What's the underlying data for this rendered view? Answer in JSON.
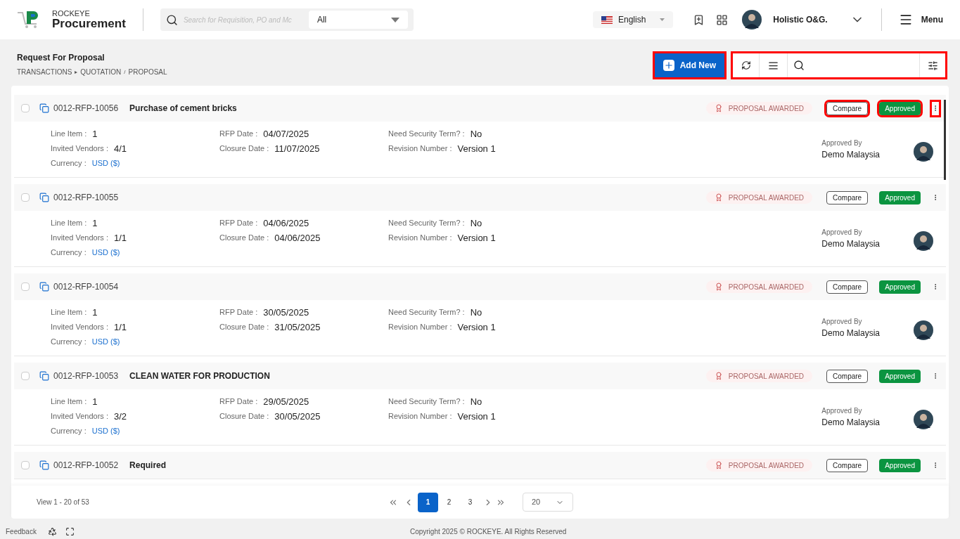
{
  "header": {
    "brand_top": "ROCKEYE",
    "brand_name": "Procurement",
    "search_placeholder": "Search for Requisition, PO and Mc",
    "search_scope": "All",
    "language": "English",
    "user_name": "Holistic O&G.",
    "menu_label": "Menu"
  },
  "page": {
    "title": "Request For Proposal",
    "breadcrumb": [
      {
        "label": "TRANSACTIONS",
        "sep": "▸"
      },
      {
        "label": "QUOTATION",
        "sep": "/"
      },
      {
        "label": "PROPOSAL"
      }
    ]
  },
  "toolbar": {
    "add_label": "Add New",
    "add_highlighted": true,
    "tools_highlighted": true
  },
  "rows": [
    {
      "checked": false,
      "number": "0012-RFP-10056",
      "title": "Purchase of cement bricks",
      "status": "PROPOSAL AWARDED",
      "compare": "Compare",
      "approval": "Approved",
      "highlighted": true,
      "details": {
        "columns": [
          [
            {
              "label": "Line Item :",
              "value": "1"
            },
            {
              "label": "Invited Vendors :",
              "value": "4/1"
            },
            {
              "label": "Currency :",
              "value": "USD ($)",
              "kind": "link"
            }
          ],
          [
            {
              "label": "RFP Date :",
              "value": "04/07/2025"
            },
            {
              "label": "Closure Date :",
              "value": "11/07/2025"
            }
          ],
          [
            {
              "label": "Need Security Term? :",
              "value": "No"
            },
            {
              "label": "Revision Number :",
              "value": "Version 1"
            }
          ]
        ],
        "approved_by_label": "Approved By",
        "approver": "Demo Malaysia"
      }
    },
    {
      "checked": false,
      "number": "0012-RFP-10055",
      "status": "PROPOSAL AWARDED",
      "compare": "Compare",
      "approval": "Approved",
      "highlighted": false,
      "details": {
        "columns": [
          [
            {
              "label": "Line Item :",
              "value": "1"
            },
            {
              "label": "Invited Vendors :",
              "value": "1/1"
            },
            {
              "label": "Currency :",
              "value": "USD ($)",
              "kind": "link"
            }
          ],
          [
            {
              "label": "RFP Date :",
              "value": "04/06/2025"
            },
            {
              "label": "Closure Date :",
              "value": "04/06/2025"
            }
          ],
          [
            {
              "label": "Need Security Term? :",
              "value": "No"
            },
            {
              "label": "Revision Number :",
              "value": "Version 1"
            }
          ]
        ],
        "approved_by_label": "Approved By",
        "approver": "Demo Malaysia"
      }
    },
    {
      "checked": false,
      "number": "0012-RFP-10054",
      "status": "PROPOSAL AWARDED",
      "compare": "Compare",
      "approval": "Approved",
      "highlighted": false,
      "details": {
        "columns": [
          [
            {
              "label": "Line Item :",
              "value": "1"
            },
            {
              "label": "Invited Vendors :",
              "value": "1/1"
            },
            {
              "label": "Currency :",
              "value": "USD ($)",
              "kind": "link"
            }
          ],
          [
            {
              "label": "RFP Date :",
              "value": "30/05/2025"
            },
            {
              "label": "Closure Date :",
              "value": "31/05/2025"
            }
          ],
          [
            {
              "label": "Need Security Term? :",
              "value": "No"
            },
            {
              "label": "Revision Number :",
              "value": "Version 1"
            }
          ]
        ],
        "approved_by_label": "Approved By",
        "approver": "Demo Malaysia"
      }
    },
    {
      "checked": false,
      "number": "0012-RFP-10053",
      "title": "CLEAN WATER FOR PRODUCTION",
      "status": "PROPOSAL AWARDED",
      "compare": "Compare",
      "approval": "Approved",
      "highlighted": false,
      "details": {
        "columns": [
          [
            {
              "label": "Line Item :",
              "value": "1"
            },
            {
              "label": "Invited Vendors :",
              "value": "3/2"
            },
            {
              "label": "Currency :",
              "value": "USD ($)",
              "kind": "link"
            }
          ],
          [
            {
              "label": "RFP Date :",
              "value": "29/05/2025"
            },
            {
              "label": "Closure Date :",
              "value": "30/05/2025"
            }
          ],
          [
            {
              "label": "Need Security Term? :",
              "value": "No"
            },
            {
              "label": "Revision Number :",
              "value": "Version 1"
            }
          ]
        ],
        "approved_by_label": "Approved By",
        "approver": "Demo Malaysia"
      }
    },
    {
      "checked": false,
      "number": "0012-RFP-10052",
      "title": "Required",
      "status": "PROPOSAL AWARDED",
      "compare": "Compare",
      "approval": "Approved",
      "highlighted": false
    }
  ],
  "pagination": {
    "summary": "View 1 - 20 of 53",
    "pages": [
      {
        "label": "1",
        "selected": true
      },
      {
        "label": "2",
        "selected": false
      },
      {
        "label": "3",
        "selected": false
      }
    ],
    "page_size": "20"
  },
  "footer": {
    "feedback": "Feedback",
    "copyright": "Copyright 2025 © ROCKEYE. All Rights Reserved"
  }
}
